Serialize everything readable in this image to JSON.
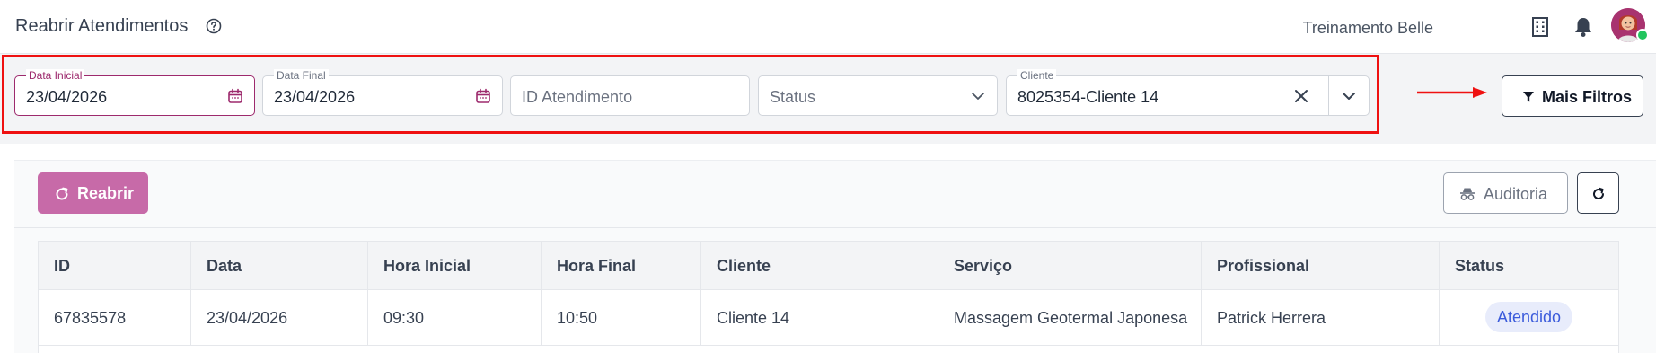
{
  "header": {
    "title": "Reabrir Atendimentos",
    "user_name": "Treinamento Belle",
    "icons": [
      "help-icon",
      "building-icon",
      "bell-icon",
      "avatar"
    ]
  },
  "filters": {
    "start_date": {
      "label": "Data Inicial",
      "value": "23/04/2026"
    },
    "end_date": {
      "label": "Data Final",
      "value": "23/04/2026"
    },
    "attendance_id": {
      "placeholder": "ID Atendimento"
    },
    "status": {
      "placeholder": "Status"
    },
    "client": {
      "label": "Cliente",
      "value": "8025354-Cliente 14"
    },
    "more_filters_label": "Mais Filtros"
  },
  "toolbar": {
    "reopen_label": "Reabrir",
    "audit_label": "Auditoria"
  },
  "table": {
    "columns": [
      "ID",
      "Data",
      "Hora Inicial",
      "Hora Final",
      "Cliente",
      "Serviço",
      "Profissional",
      "Status"
    ],
    "rows": [
      [
        "67835578",
        "23/04/2026",
        "09:30",
        "10:50",
        "Cliente 14",
        "Massagem Geotermal Japonesa",
        "Patrick Herrera",
        "Atendido"
      ]
    ]
  },
  "colors": {
    "brand": "#9d2a6d",
    "reopen_button": "#c76aa8",
    "highlight": "#ef1111",
    "status_badge_bg": "#e8ecfb",
    "status_badge_text": "#3b5bdb"
  }
}
